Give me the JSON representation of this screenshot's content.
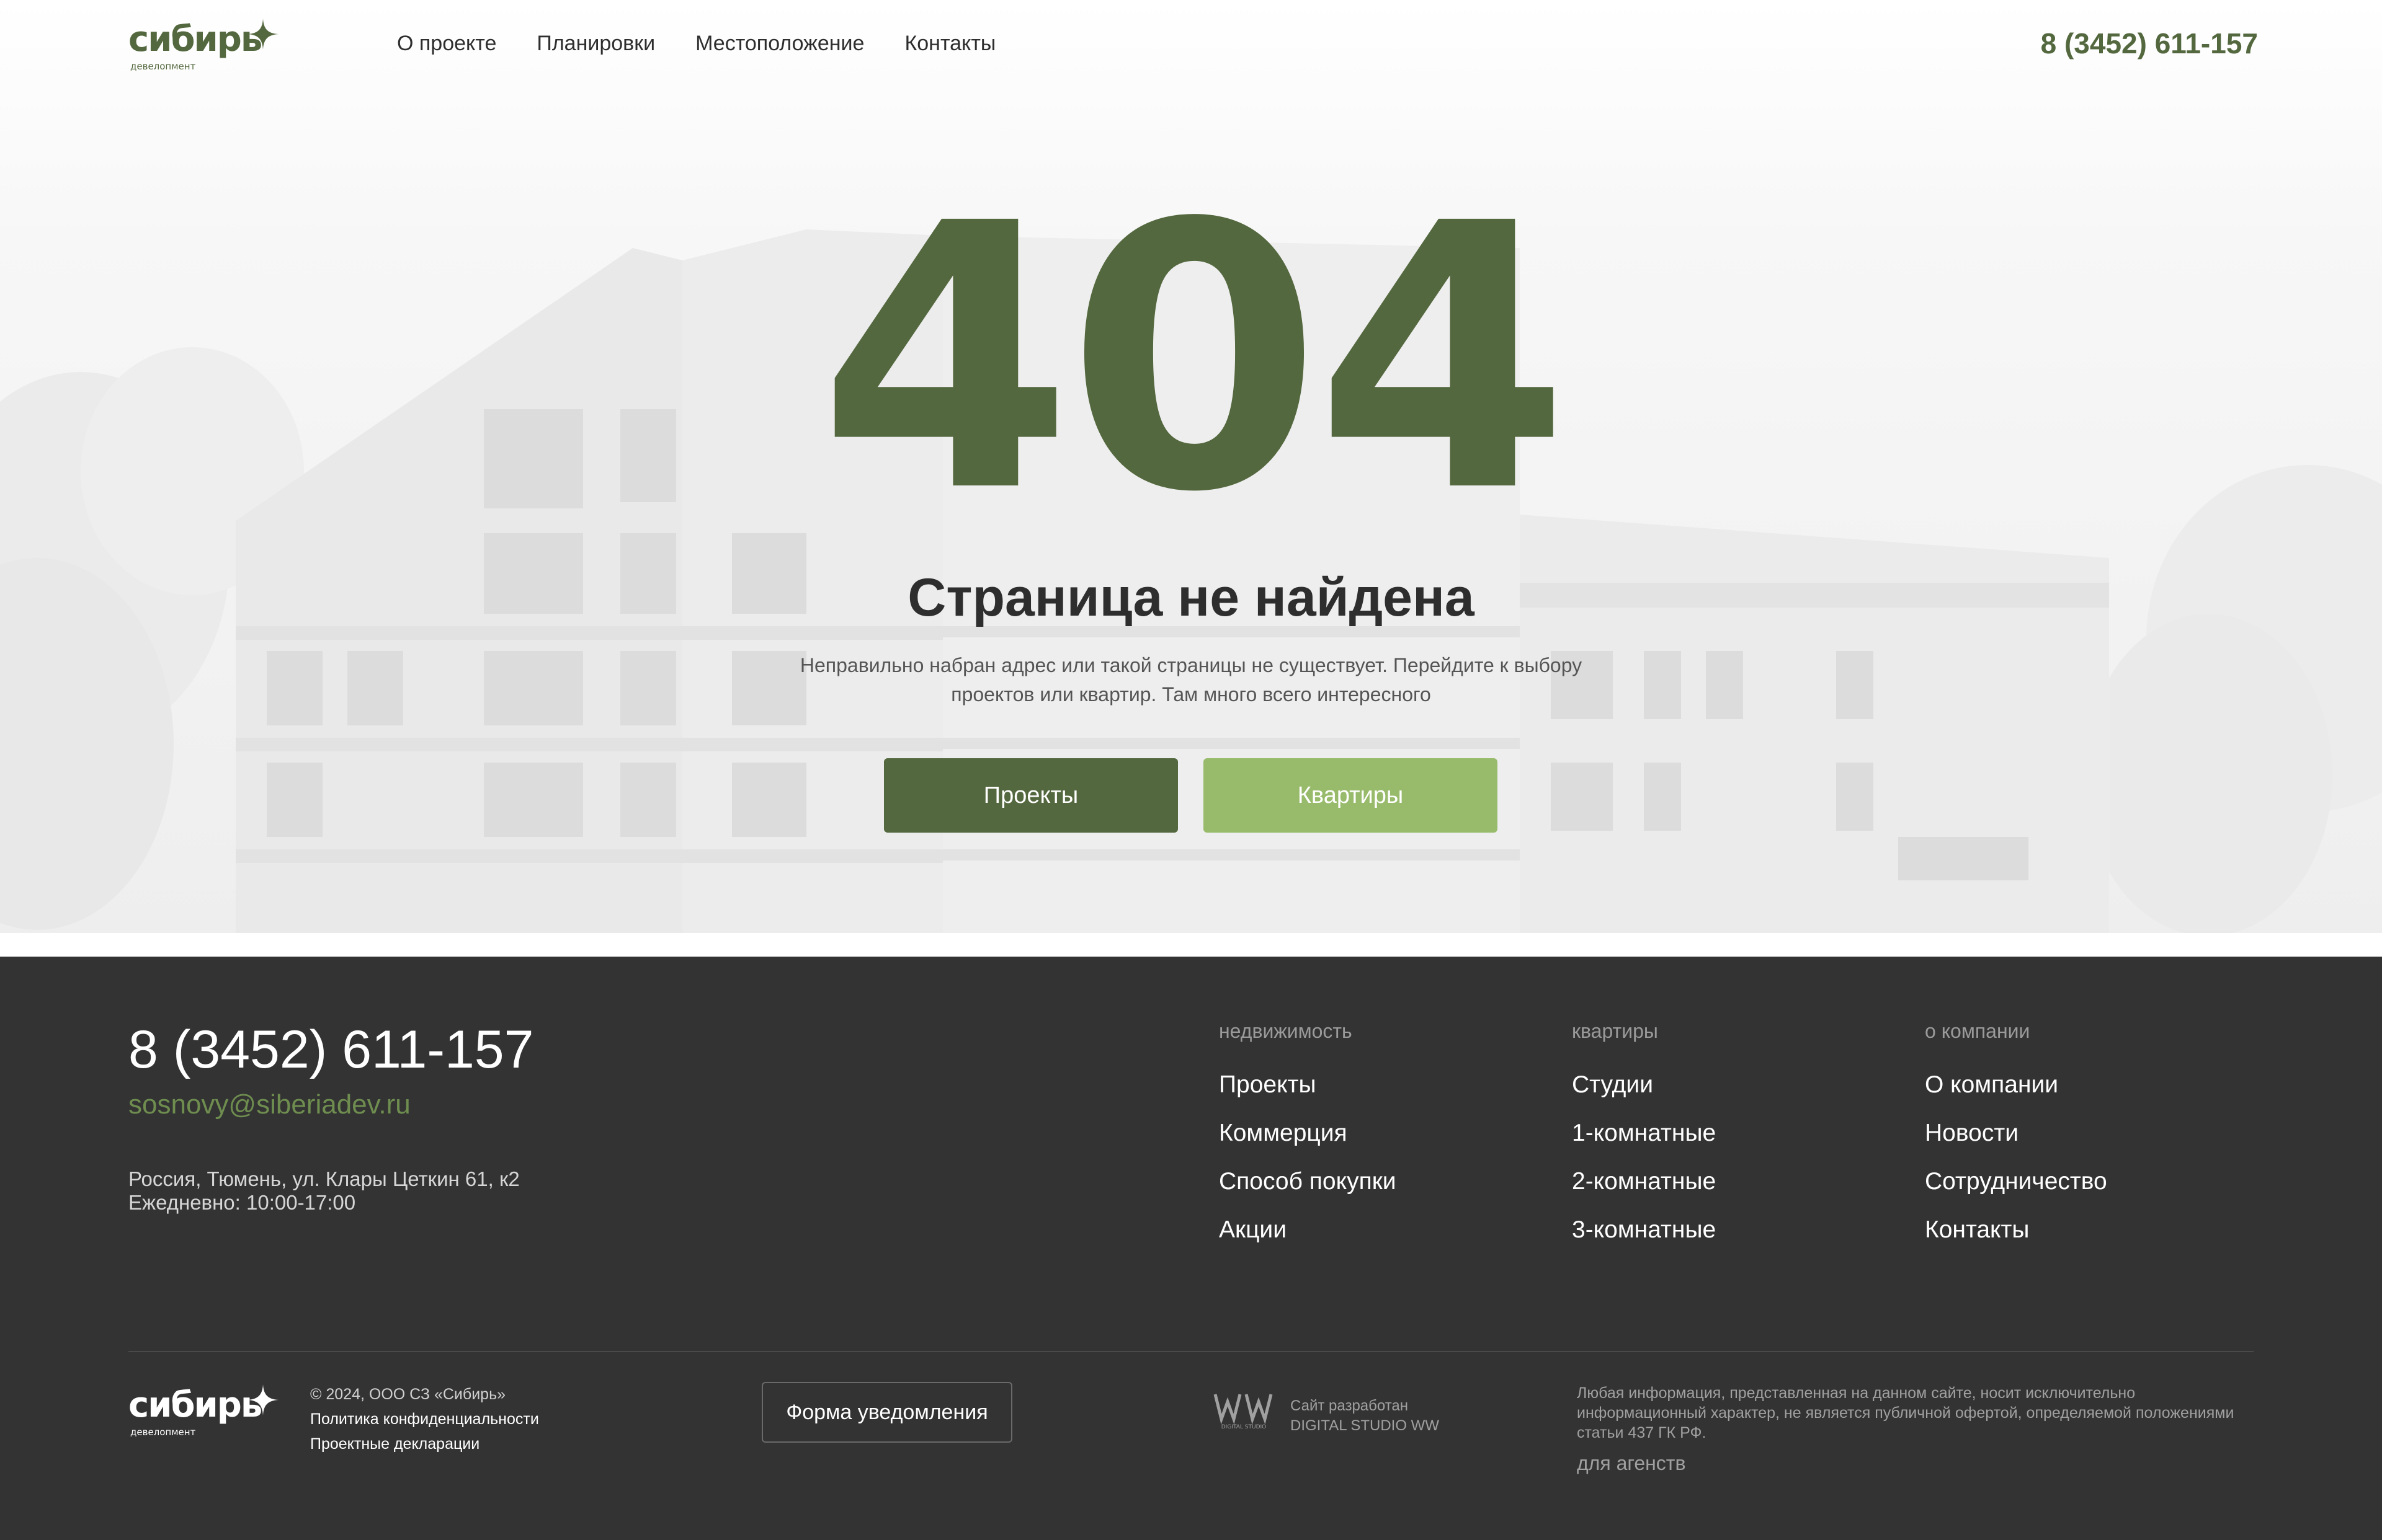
{
  "brand": {
    "name": "сибирь",
    "tagline": "девелопмент"
  },
  "header": {
    "nav": [
      {
        "label": "О проекте"
      },
      {
        "label": "Планировки"
      },
      {
        "label": "Местоположение"
      },
      {
        "label": "Контакты"
      }
    ],
    "phone": "8 (3452) 611-157"
  },
  "error": {
    "code": "404",
    "title": "Страница не найдена",
    "message": "Неправильно набран адрес или такой страницы не существует. Перейдите к выбору проектов или квартир. Там много всего интересного",
    "buttons": {
      "projects": "Проекты",
      "flats": "Квартиры"
    }
  },
  "footer": {
    "phone": "8 (3452) 611-157",
    "email": "sosnovy@siberiadev.ru",
    "address": "Россия, Тюмень, ул. Клары Цеткин 61, к2",
    "hours": "Ежедневно: 10:00-17:00",
    "columns": [
      {
        "title": "недвижимость",
        "links": [
          "Проекты",
          "Коммерция",
          "Способ покупки",
          "Акции"
        ]
      },
      {
        "title": "квартиры",
        "links": [
          "Студии",
          "1-комнатные",
          "2-комнатные",
          "3-комнатные"
        ]
      },
      {
        "title": "о компании",
        "links": [
          "О компании",
          "Новости",
          "Сотрудничество",
          "Контакты"
        ]
      }
    ],
    "copyright": "© 2024, ООО СЗ «Сибирь»",
    "privacy_link": "Политика конфиденциальности",
    "declarations_link": "Проектные декларации",
    "notify_button": "Форма уведомления",
    "developer": {
      "logo_label": "DIGITAL STUDIO",
      "line1": "Сайт разработан",
      "line2": "DIGITAL STUDIO WW"
    },
    "disclaimer": "Любая информация, представленная на данном сайте, носит исключительно информационный характер, не является публичной офертой, определяемой положениями статьи 437 ГК РФ.",
    "agents_link": "для агенств"
  },
  "colors": {
    "brand_green": "#53683e",
    "light_green": "#98bb6b",
    "email_green": "#6e8d4f",
    "footer_bg": "#333333"
  },
  "icons": [
    "sparkle-star-icon",
    "digital-studio-ww-logo"
  ]
}
